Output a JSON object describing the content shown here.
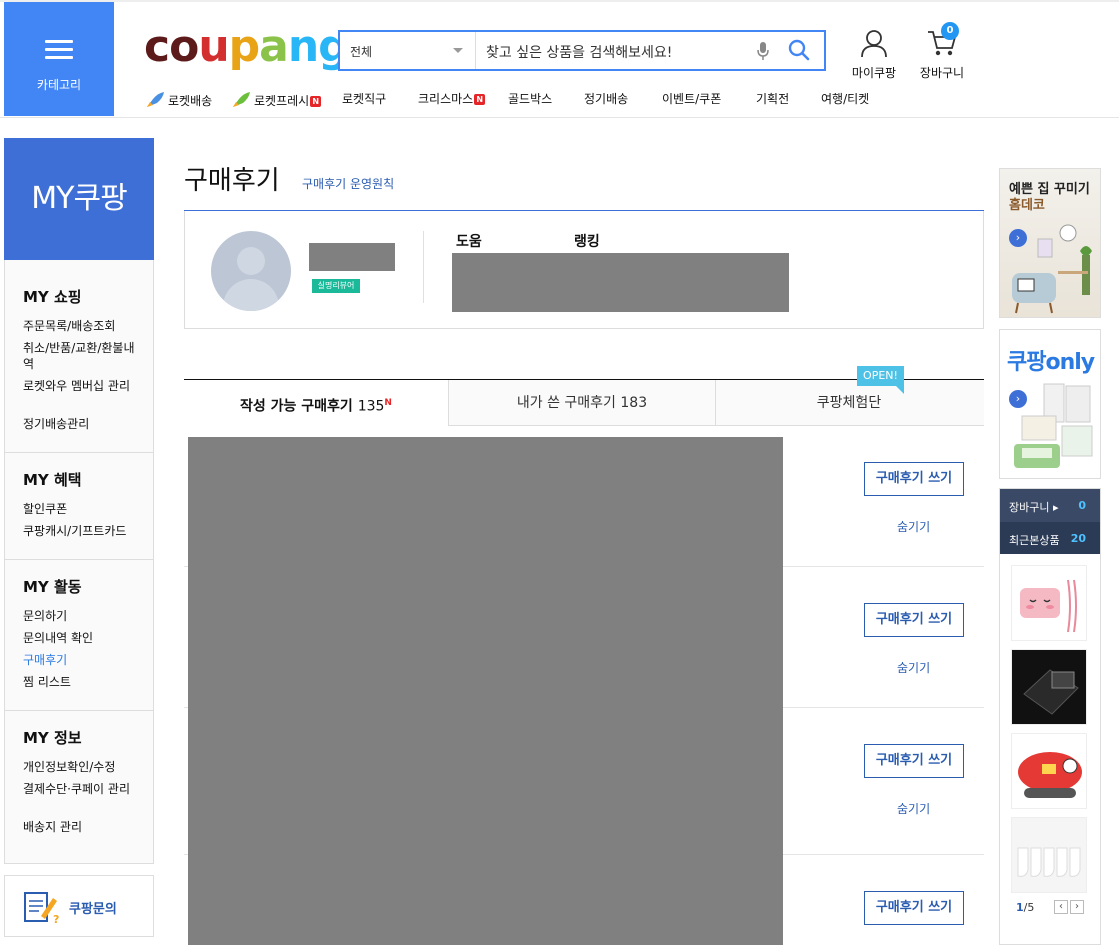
{
  "header": {
    "category_label": "카테고리",
    "search": {
      "scope": "전체",
      "placeholder": "찾고 싶은 상품을 검색해보세요!"
    },
    "my_coupang": "마이쿠팡",
    "cart_label": "장바구니",
    "cart_count": "0",
    "nav": [
      {
        "label": "로켓배송"
      },
      {
        "label": "로켓프레시",
        "badge": "N"
      },
      {
        "label": "로켓직구"
      },
      {
        "label": "크리스마스",
        "badge": "N"
      },
      {
        "label": "골드박스"
      },
      {
        "label": "정기배송"
      },
      {
        "label": "이벤트/쿠폰"
      },
      {
        "label": "기획전"
      },
      {
        "label": "여행/티켓"
      }
    ]
  },
  "sidebar": {
    "title": "MY쿠팡",
    "groups": [
      {
        "title": "MY 쇼핑",
        "items": [
          "주문목록/배송조회",
          "취소/반품/교환/환불내역",
          "로켓와우 멤버십 관리",
          "정기배송관리"
        ]
      },
      {
        "title": "MY 혜택",
        "items": [
          "할인쿠폰",
          "쿠팡캐시/기프트카드"
        ]
      },
      {
        "title": "MY 활동",
        "items": [
          "문의하기",
          "문의내역 확인",
          "구매후기",
          "찜 리스트"
        ]
      },
      {
        "title": "MY 정보",
        "items": [
          "개인정보확인/수정",
          "결제수단·쿠페이 관리",
          "배송지 관리"
        ]
      }
    ],
    "active_item": "구매후기",
    "inquiry_label": "쿠팡문의"
  },
  "main": {
    "title": "구매후기",
    "policy_link": "구매후기 운영원칙",
    "profile": {
      "badge": "실명리뷰어",
      "stat_help": "도움",
      "stat_rank": "랭킹"
    },
    "tabs": [
      {
        "label": "작성 가능 구매후기",
        "count": "135",
        "new": "N"
      },
      {
        "label": "내가 쓴 구매후기",
        "count": "183"
      },
      {
        "label": "쿠팡체험단",
        "badge": "OPEN!"
      }
    ],
    "write_button": "구매후기 쓰기",
    "hide_link": "숨기기"
  },
  "right": {
    "ad1": {
      "line1": "예쁜 집 꾸미기",
      "line2": "홈데코"
    },
    "ad2": {
      "title": "쿠팡only"
    },
    "cart_label": "장바구니 ▸",
    "cart_count": "0",
    "recent_label": "최근본상품",
    "recent_count": "20",
    "page_current": "1",
    "page_total": "/5"
  },
  "colors": {
    "brand_blue": "#3d6fd6",
    "search_border": "#4285f4",
    "link": "#2a5cb0",
    "new_red": "#e52528"
  }
}
